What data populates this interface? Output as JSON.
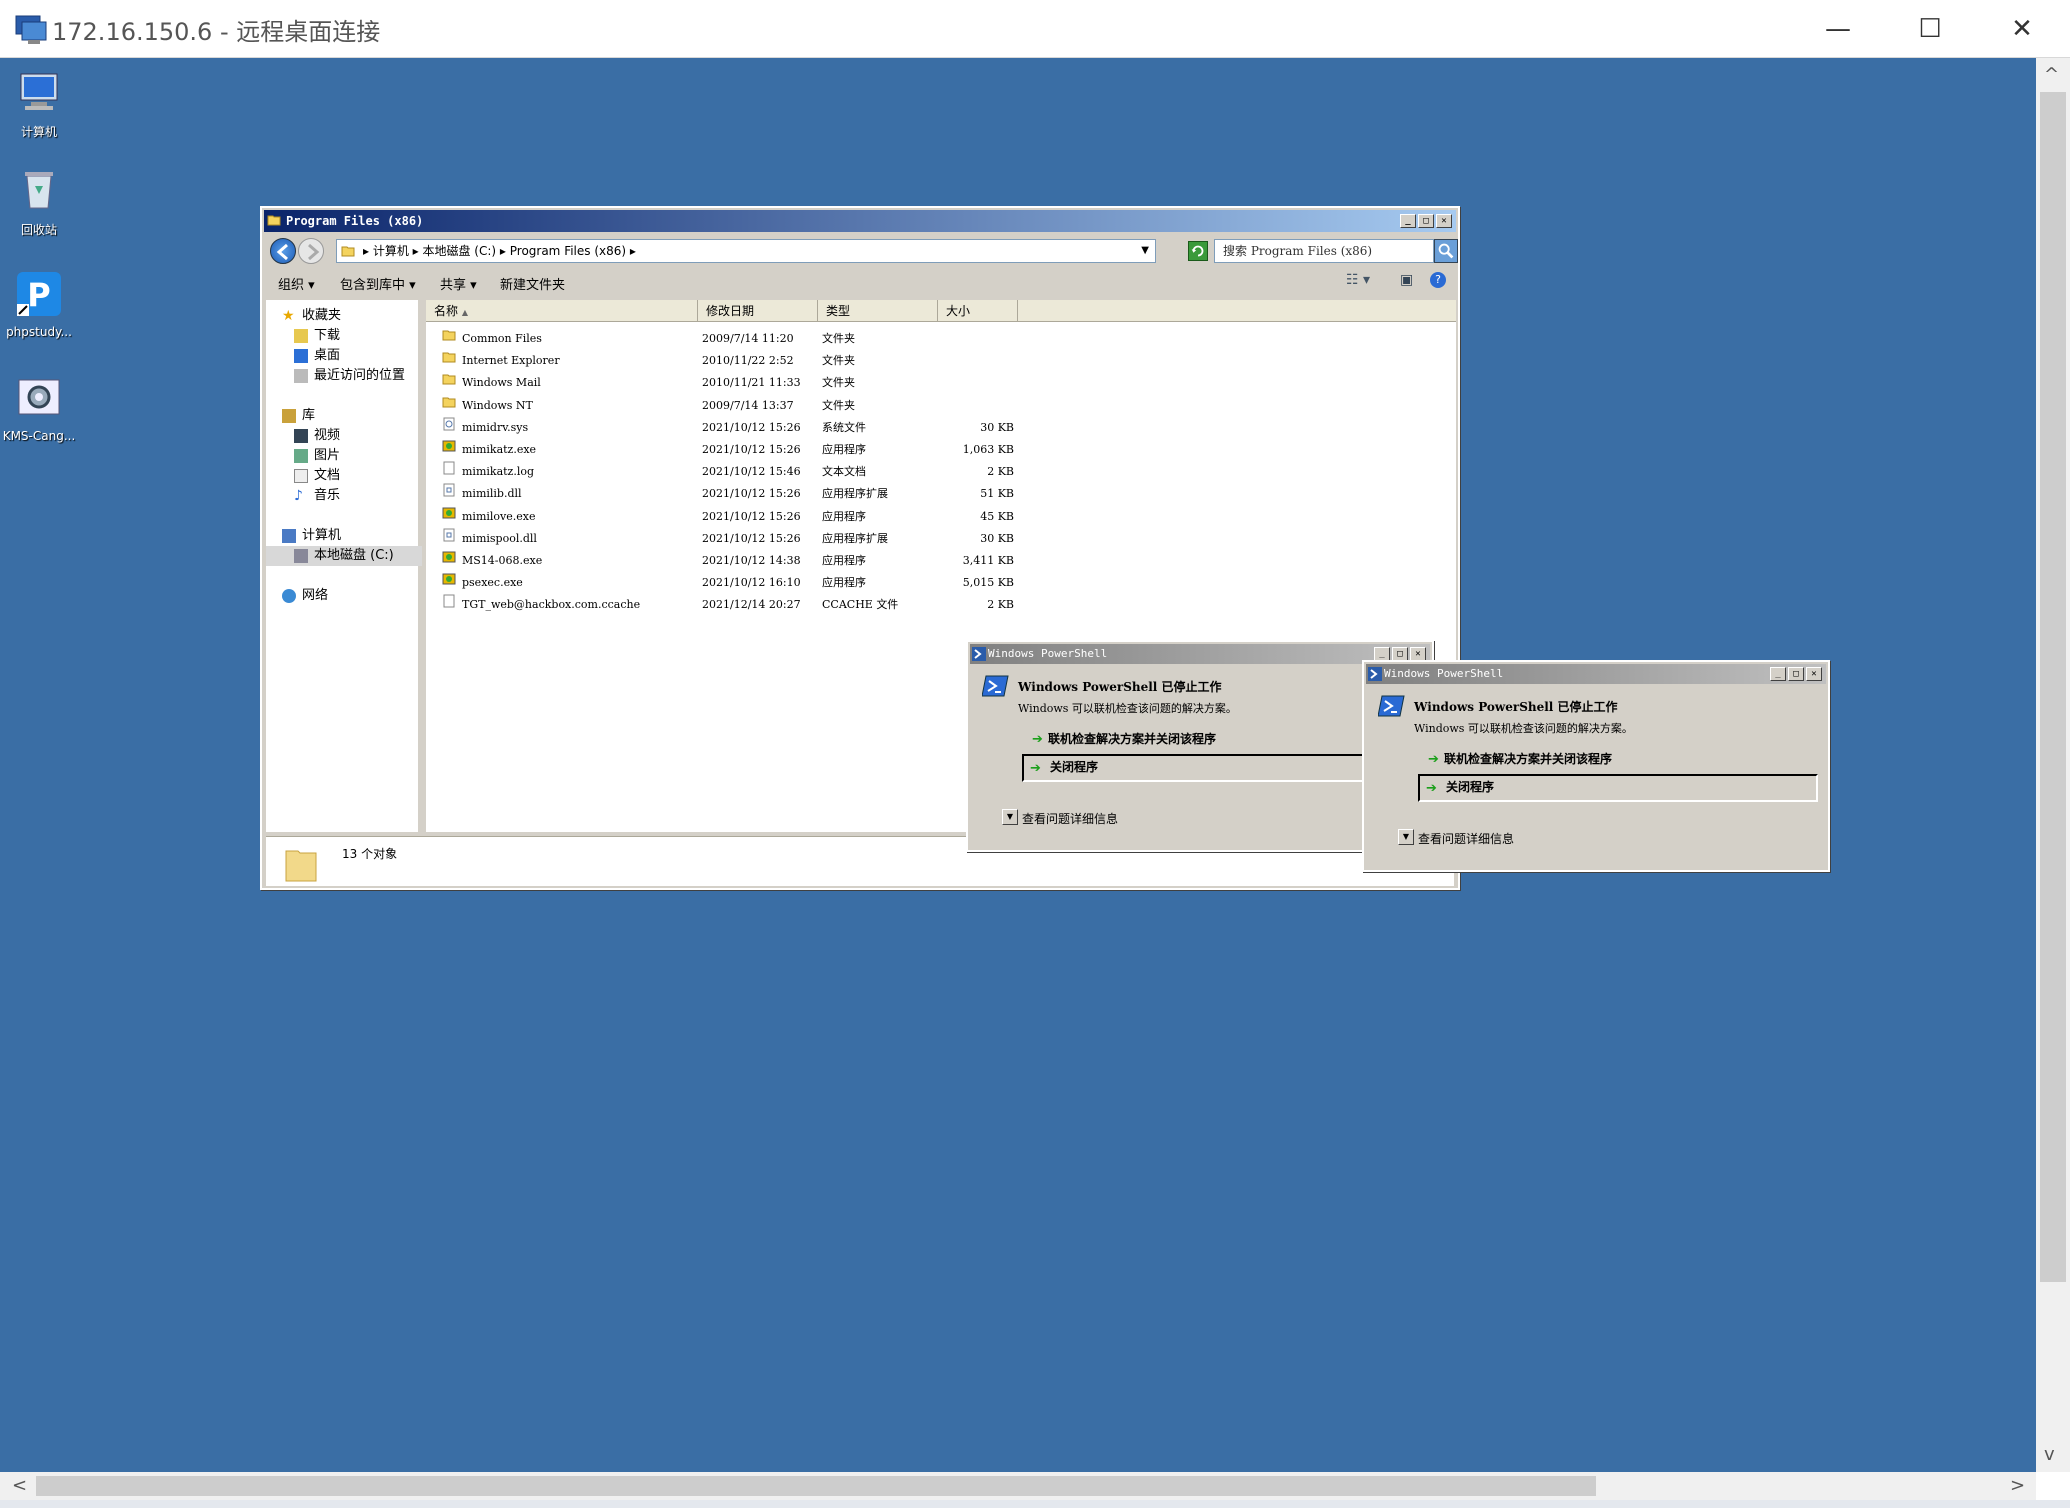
{
  "rdp": {
    "title": "172.16.150.6 - 远程桌面连接",
    "minimize": "—",
    "maximize": "☐",
    "close": "✕"
  },
  "desktop_icons": [
    {
      "label": "计算机",
      "icon": "computer-icon"
    },
    {
      "label": "回收站",
      "icon": "recycle-bin-icon"
    },
    {
      "label": "phpstudy...",
      "icon": "phpstudy-icon"
    },
    {
      "label": "KMS-Cang...",
      "icon": "kms-icon"
    }
  ],
  "explorer": {
    "title": "Program Files (x86)",
    "address": "▸ 计算机 ▸ 本地磁盘 (C:) ▸ Program Files (x86) ▸",
    "search_placeholder": "搜索 Program Files (x86)",
    "toolbar": {
      "organize": "组织 ▾",
      "include_library": "包含到库中 ▾",
      "share": "共享 ▾",
      "new_folder": "新建文件夹"
    },
    "nav": {
      "favorites": "收藏夹",
      "downloads": "下载",
      "desktop": "桌面",
      "recent": "最近访问的位置",
      "library": "库",
      "videos": "视频",
      "pictures": "图片",
      "documents": "文档",
      "music": "音乐",
      "computer": "计算机",
      "local_disk": "本地磁盘 (C:)",
      "network": "网络"
    },
    "columns": {
      "name": "名称",
      "date": "修改日期",
      "type": "类型",
      "size": "大小"
    },
    "files": [
      {
        "name": "Common Files",
        "date": "2009/7/14 11:20",
        "type": "文件夹",
        "size": "",
        "icon": "folder"
      },
      {
        "name": "Internet Explorer",
        "date": "2010/11/22 2:52",
        "type": "文件夹",
        "size": "",
        "icon": "folder"
      },
      {
        "name": "Windows Mail",
        "date": "2010/11/21 11:33",
        "type": "文件夹",
        "size": "",
        "icon": "folder"
      },
      {
        "name": "Windows NT",
        "date": "2009/7/14 13:37",
        "type": "文件夹",
        "size": "",
        "icon": "folder"
      },
      {
        "name": "mimidrv.sys",
        "date": "2021/10/12 15:26",
        "type": "系统文件",
        "size": "30 KB",
        "icon": "sys"
      },
      {
        "name": "mimikatz.exe",
        "date": "2021/10/12 15:26",
        "type": "应用程序",
        "size": "1,063 KB",
        "icon": "exe"
      },
      {
        "name": "mimikatz.log",
        "date": "2021/10/12 15:46",
        "type": "文本文档",
        "size": "2 KB",
        "icon": "txt"
      },
      {
        "name": "mimilib.dll",
        "date": "2021/10/12 15:26",
        "type": "应用程序扩展",
        "size": "51 KB",
        "icon": "dll"
      },
      {
        "name": "mimilove.exe",
        "date": "2021/10/12 15:26",
        "type": "应用程序",
        "size": "45 KB",
        "icon": "exe"
      },
      {
        "name": "mimispool.dll",
        "date": "2021/10/12 15:26",
        "type": "应用程序扩展",
        "size": "30 KB",
        "icon": "dll"
      },
      {
        "name": "MS14-068.exe",
        "date": "2021/10/12 14:38",
        "type": "应用程序",
        "size": "3,411 KB",
        "icon": "exe"
      },
      {
        "name": "psexec.exe",
        "date": "2021/10/12 16:10",
        "type": "应用程序",
        "size": "5,015 KB",
        "icon": "exe"
      },
      {
        "name": "TGT_web@hackbox.com.ccache",
        "date": "2021/12/14 20:27",
        "type": "CCACHE 文件",
        "size": "2 KB",
        "icon": "file"
      }
    ],
    "status": "13 个对象"
  },
  "ps_dialog": {
    "title": "Windows PowerShell",
    "heading": "Windows PowerShell 已停止工作",
    "sub": "Windows 可以联机检查该问题的解决方案。",
    "option_check": "联机检查解决方案并关闭该程序",
    "option_close": "关闭程序",
    "details": "查看问题详细信息"
  },
  "colors": {
    "desktop": "#3a6ea5",
    "title_active": "#0a246a",
    "title_inactive": "#808080"
  }
}
